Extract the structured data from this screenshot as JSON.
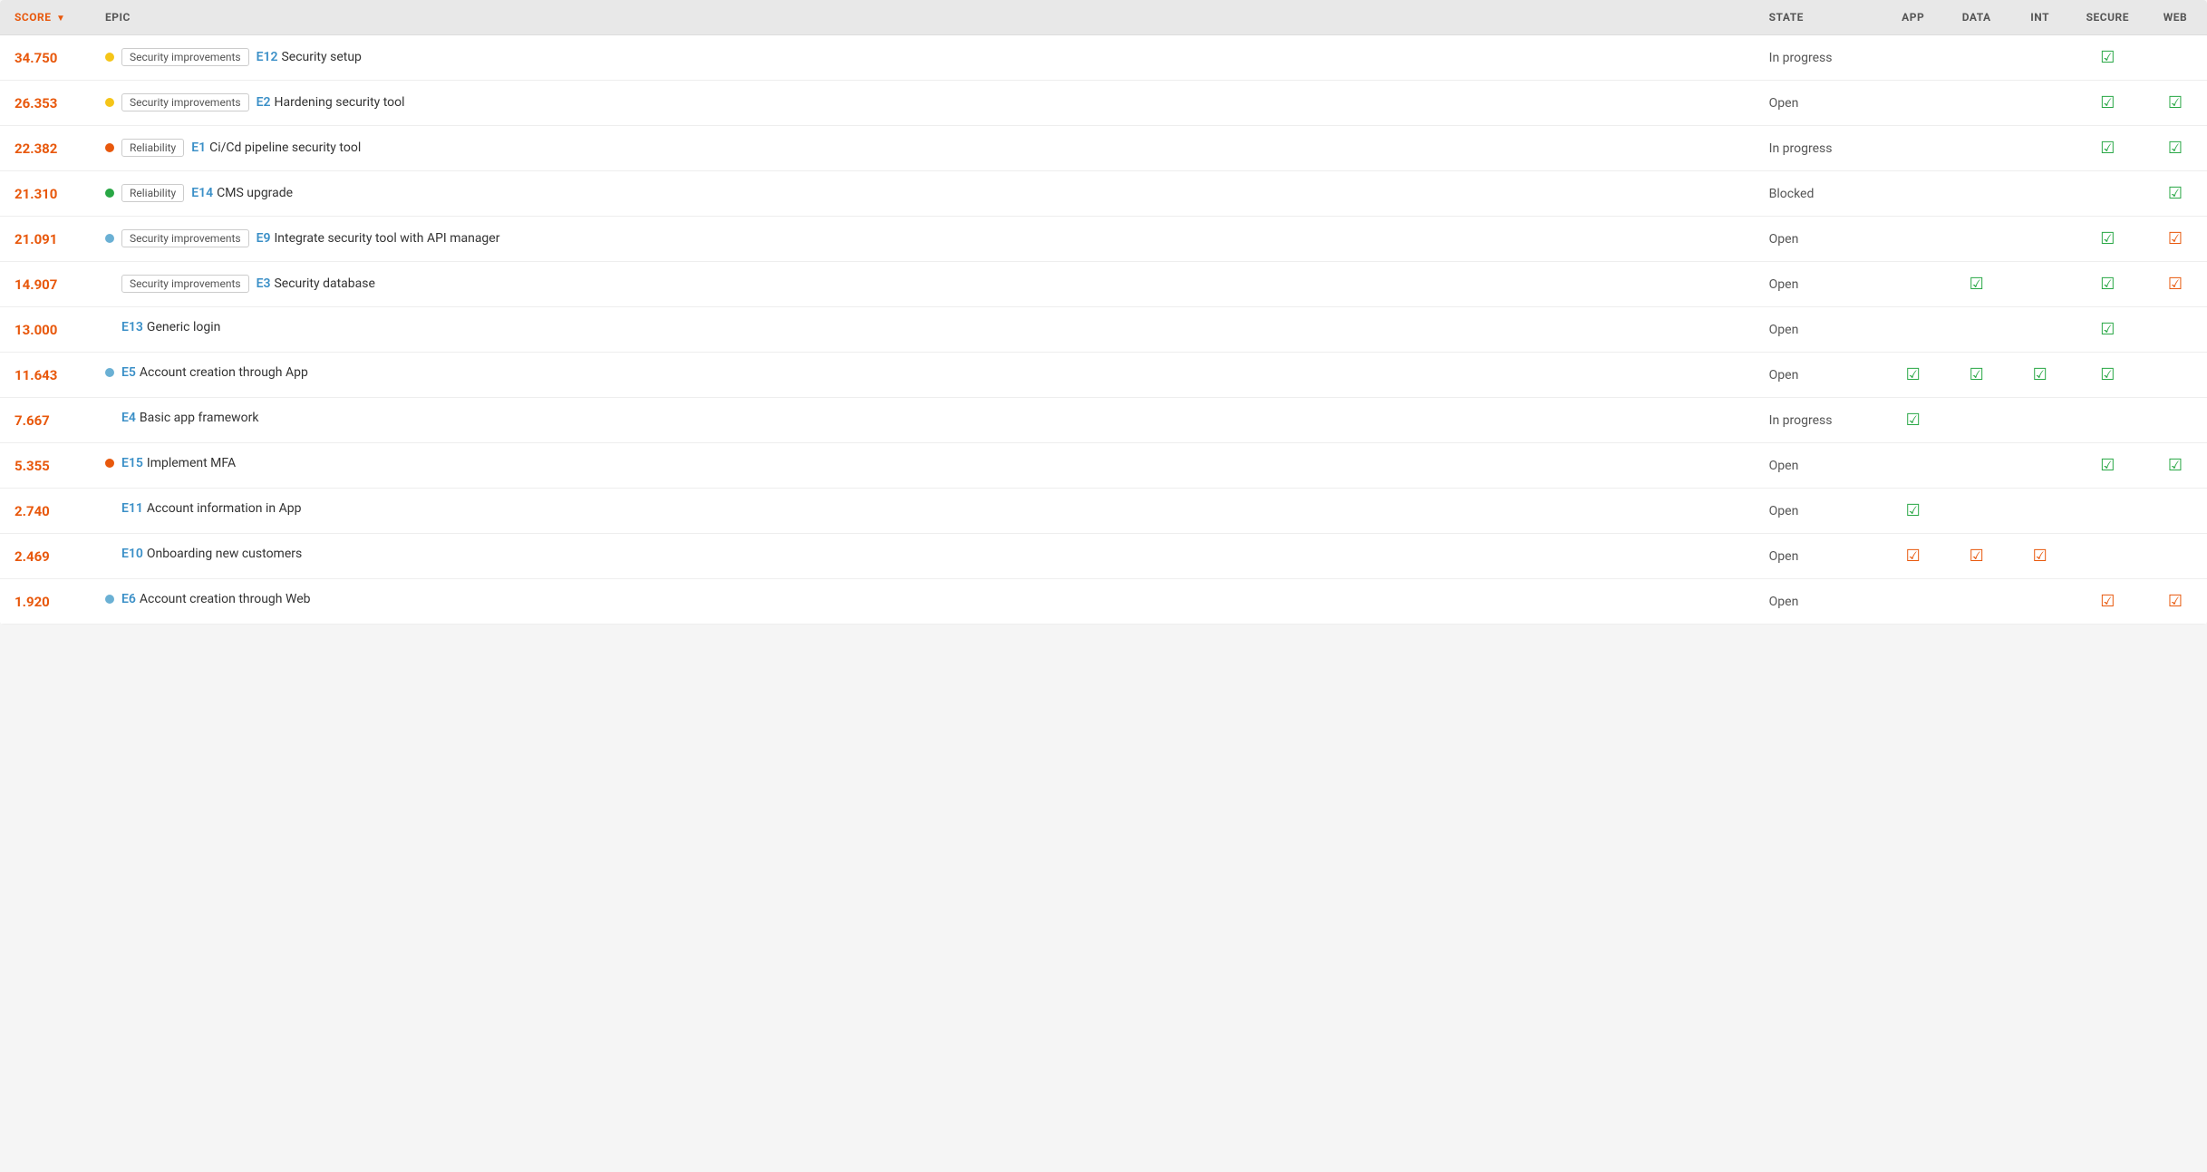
{
  "table": {
    "columns": {
      "score": "SCORE",
      "epic": "EPIC",
      "state": "STATE",
      "app": "APP",
      "data": "DATA",
      "int": "INT",
      "secure": "SECURE",
      "web": "WEB"
    },
    "rows": [
      {
        "score": "34.750",
        "dot": "yellow",
        "tag": "Security improvements",
        "epicId": "E12",
        "epicTitle": "Security setup",
        "state": "In progress",
        "app": "",
        "data": "",
        "int": "",
        "secure": "green",
        "web": ""
      },
      {
        "score": "26.353",
        "dot": "yellow",
        "tag": "Security improvements",
        "epicId": "E2",
        "epicTitle": "Hardening security tool",
        "state": "Open",
        "app": "",
        "data": "",
        "int": "",
        "secure": "green",
        "web": "green"
      },
      {
        "score": "22.382",
        "dot": "orange",
        "tag": "Reliability",
        "epicId": "E1",
        "epicTitle": "Ci/Cd pipeline security tool",
        "state": "In progress",
        "app": "",
        "data": "",
        "int": "",
        "secure": "green",
        "web": "green"
      },
      {
        "score": "21.310",
        "dot": "green",
        "tag": "Reliability",
        "epicId": "E14",
        "epicTitle": "CMS upgrade",
        "state": "Blocked",
        "app": "",
        "data": "",
        "int": "",
        "secure": "",
        "web": "green"
      },
      {
        "score": "21.091",
        "dot": "blue",
        "tag": "Security improvements",
        "epicId": "E9",
        "epicTitle": "Integrate security tool with API manager",
        "state": "Open",
        "app": "",
        "data": "",
        "int": "",
        "secure": "green",
        "web": "red"
      },
      {
        "score": "14.907",
        "dot": "",
        "tag": "Security improvements",
        "epicId": "E3",
        "epicTitle": "Security database",
        "state": "Open",
        "app": "",
        "data": "green",
        "int": "",
        "secure": "green",
        "web": "red"
      },
      {
        "score": "13.000",
        "dot": "",
        "tag": "",
        "epicId": "E13",
        "epicTitle": "Generic login",
        "state": "Open",
        "app": "",
        "data": "",
        "int": "",
        "secure": "green",
        "web": ""
      },
      {
        "score": "11.643",
        "dot": "blue",
        "tag": "",
        "epicId": "E5",
        "epicTitle": "Account creation through App",
        "state": "Open",
        "app": "green",
        "data": "green",
        "int": "green",
        "secure": "green",
        "web": ""
      },
      {
        "score": "7.667",
        "dot": "",
        "tag": "",
        "epicId": "E4",
        "epicTitle": "Basic app framework",
        "state": "In progress",
        "app": "green",
        "data": "",
        "int": "",
        "secure": "",
        "web": ""
      },
      {
        "score": "5.355",
        "dot": "orange",
        "tag": "",
        "epicId": "E15",
        "epicTitle": "Implement MFA",
        "state": "Open",
        "app": "",
        "data": "",
        "int": "",
        "secure": "green",
        "web": "green"
      },
      {
        "score": "2.740",
        "dot": "",
        "tag": "",
        "epicId": "E11",
        "epicTitle": "Account information in App",
        "state": "Open",
        "app": "green",
        "data": "",
        "int": "",
        "secure": "",
        "web": ""
      },
      {
        "score": "2.469",
        "dot": "",
        "tag": "",
        "epicId": "E10",
        "epicTitle": "Onboarding new customers",
        "state": "Open",
        "app": "red",
        "data": "red",
        "int": "red",
        "secure": "",
        "web": ""
      },
      {
        "score": "1.920",
        "dot": "blue",
        "tag": "",
        "epicId": "E6",
        "epicTitle": "Account creation through Web",
        "state": "Open",
        "app": "",
        "data": "",
        "int": "",
        "secure": "red",
        "web": "red"
      }
    ]
  }
}
